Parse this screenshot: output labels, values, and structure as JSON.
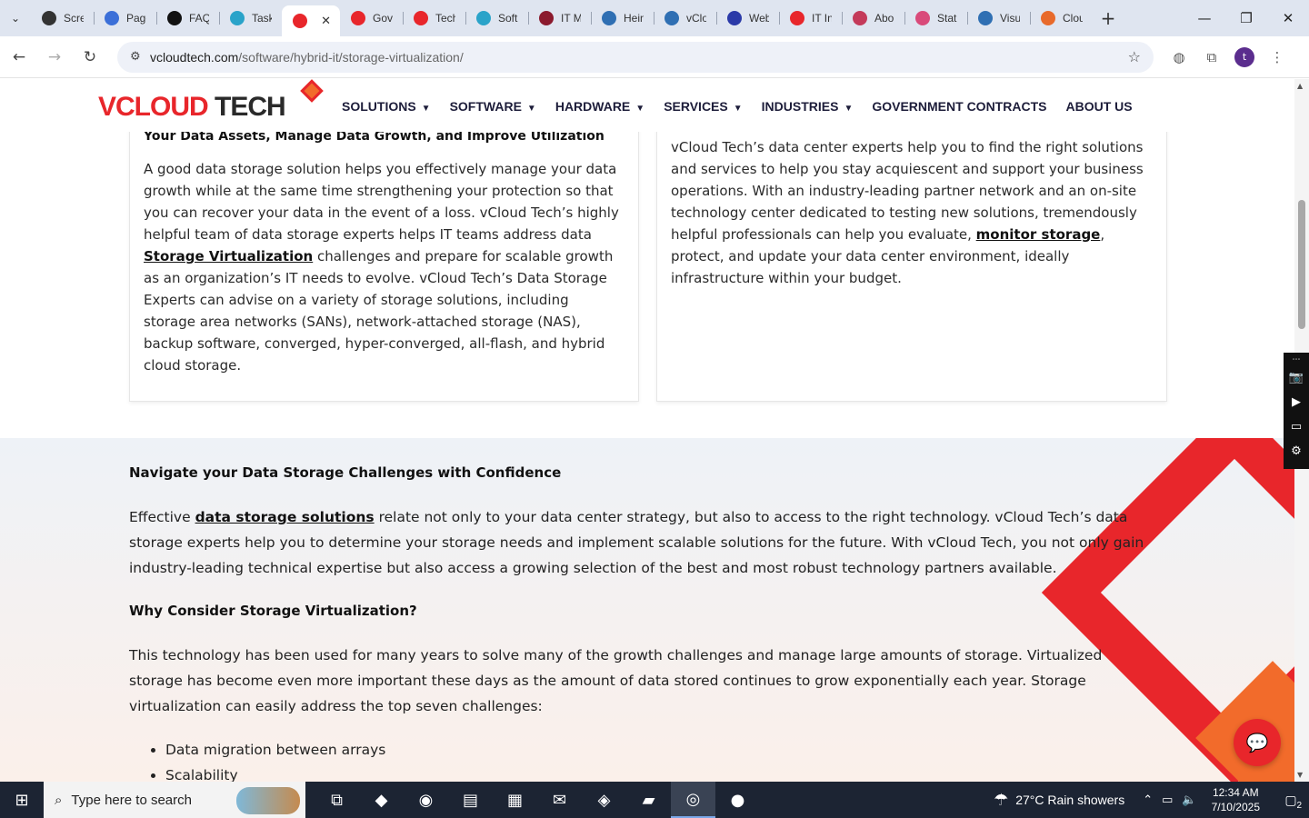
{
  "browser": {
    "tabs": [
      {
        "label": "Scre",
        "color": "#333333"
      },
      {
        "label": "Page",
        "color": "#3b6fd8"
      },
      {
        "label": "FAQ",
        "color": "#111111"
      },
      {
        "label": "Task",
        "color": "#2aa3c9"
      },
      {
        "label": "",
        "color": "#e8262b",
        "active": true
      },
      {
        "label": "Gov",
        "color": "#e8262b"
      },
      {
        "label": "Tech",
        "color": "#e8262b"
      },
      {
        "label": "Soft",
        "color": "#2aa3c9"
      },
      {
        "label": "IT M",
        "color": "#8b1a2e"
      },
      {
        "label": "Hein",
        "color": "#2f6fb3"
      },
      {
        "label": "vClo",
        "color": "#2f6fb3"
      },
      {
        "label": "Web",
        "color": "#2b3aa8"
      },
      {
        "label": "IT In",
        "color": "#e8262b"
      },
      {
        "label": "Abo",
        "color": "#c43a5a"
      },
      {
        "label": "Stat",
        "color": "#d94a7a"
      },
      {
        "label": "Visu",
        "color": "#2f6fb3"
      },
      {
        "label": "Clou",
        "color": "#e86a2b"
      }
    ],
    "url_host": "vcloudtech.com",
    "url_path": "/software/hybrid-it/storage-virtualization/",
    "avatar_letter": "t"
  },
  "site": {
    "logo_v": "V",
    "logo_cloud": "CLOUD",
    "logo_tech": " TECH",
    "nav": [
      {
        "label": "SOLUTIONS",
        "dropdown": true
      },
      {
        "label": "SOFTWARE",
        "dropdown": true
      },
      {
        "label": "HARDWARE",
        "dropdown": true
      },
      {
        "label": "SERVICES",
        "dropdown": true
      },
      {
        "label": "INDUSTRIES",
        "dropdown": true
      },
      {
        "label": "GOVERNMENT CONTRACTS",
        "dropdown": false
      },
      {
        "label": "ABOUT US",
        "dropdown": false
      }
    ]
  },
  "cards": {
    "left": {
      "heading": "Your Data Assets, Manage Data Growth, and Improve Utilization",
      "p_before": "A good data storage solution helps you effectively manage your data growth while at the same time strengthening your protection so that you can recover your data in the event of a loss. vCloud Tech’s highly helpful team of data storage experts helps IT teams address data ",
      "link": "Storage Virtualization",
      "p_after": " challenges and prepare for scalable growth as an organization’s IT needs to evolve. vCloud Tech’s Data Storage Experts can advise on a variety of storage solutions, including storage area networks (SANs), network-attached storage (NAS), backup software, converged, hyper-converged, all-flash, and hybrid cloud storage."
    },
    "right": {
      "p_before": "vCloud Tech’s data center experts help you to find the right solutions and services to help you stay acquiescent and support your business operations. With an industry-leading partner network and an on-site technology center dedicated to testing new solutions, tremendously helpful professionals can help you evaluate, ",
      "link": "monitor storage",
      "p_after": ", protect, and update your data center environment, ideally infrastructure within your budget."
    }
  },
  "section2": {
    "heading1": "Navigate your Data Storage Challenges with Confidence",
    "p1_before": "Effective ",
    "p1_link": "data storage solutions",
    "p1_after": " relate not only to your data center strategy, but also to access to the right technology. vCloud Tech’s data storage experts help you to determine your storage needs and implement scalable solutions for the future. With vCloud Tech, you not only gain industry-leading technical expertise but also access a growing selection of the best and most robust technology partners available.",
    "heading2": "Why Consider Storage Virtualization?",
    "p2": "This technology has been used for many years to solve many of the growth challenges and manage large amounts of storage. Virtualized storage has become even more important these days as the amount of data stored continues to grow exponentially each year. Storage virtualization can easily  address the  top seven challenges:",
    "list": [
      "Data migration between arrays",
      "Scalability"
    ]
  },
  "taskbar": {
    "search_placeholder": "Type here to search",
    "weather": "27°C  Rain showers",
    "time": "12:34 AM",
    "date": "7/10/2025",
    "notif_count": "2"
  }
}
